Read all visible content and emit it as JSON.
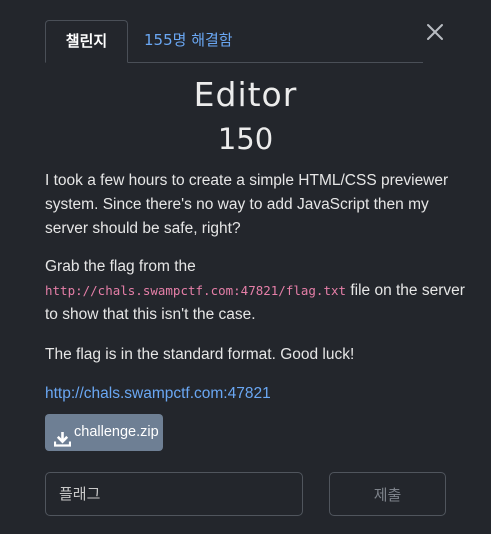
{
  "tabs": {
    "challenge_label": "챌린지",
    "solves_label": "155명 해결함"
  },
  "challenge": {
    "name": "Editor",
    "points": "150",
    "paragraph1": "I took a few hours to create a simple HTML/CSS previewer system. Since there's no way to add JavaScript then my server should be safe, right?",
    "paragraph2_prefix": "Grab the flag from the ",
    "paragraph2_code": "http://chals.swampctf.com:47821/flag.txt",
    "paragraph2_suffix": " file on the server to show that this isn't the case.",
    "paragraph3": "The flag is in the standard format. Good luck!",
    "link": "http://chals.swampctf.com:47821"
  },
  "download": {
    "label": "challenge.zip",
    "icon": "download-icon"
  },
  "submit_form": {
    "placeholder": "플래그",
    "value": "",
    "submit_label": "제출"
  },
  "close_icon": "close-icon",
  "colors": {
    "background": "#23262c",
    "accent": "#6aa7f3",
    "code": "#e57fa8",
    "download_button": "#6e7f94"
  }
}
